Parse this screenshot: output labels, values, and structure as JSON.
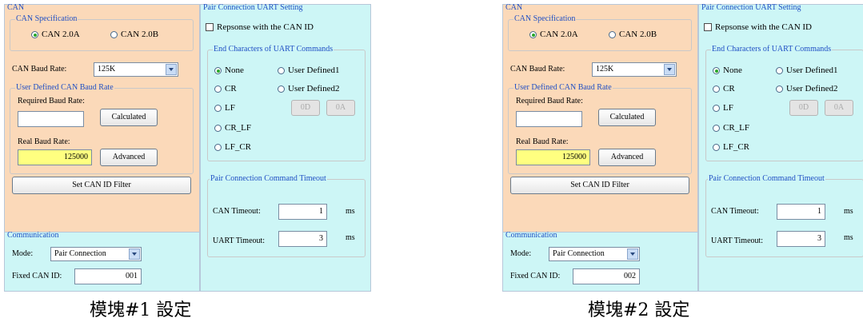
{
  "modules": [
    {
      "caption": "模塊#1 設定",
      "can": {
        "title": "CAN",
        "spec_title": "CAN Specification",
        "spec_a": "CAN 2.0A",
        "spec_b": "CAN 2.0B",
        "spec_selected": "CAN 2.0A",
        "baud_label": "CAN Baud Rate:",
        "baud_value": "125K",
        "user_title": "User Defined CAN Baud Rate",
        "required_label": "Required Baud Rate:",
        "required_value": "",
        "calculated_btn": "Calculated",
        "real_label": "Real Baud Rate:",
        "real_value": "125000",
        "advanced_btn": "Advanced",
        "filter_btn": "Set CAN ID Filter"
      },
      "comm": {
        "title": "Communication",
        "mode_label": "Mode:",
        "mode_value": "Pair Connection",
        "fixed_label": "Fixed CAN ID:",
        "fixed_value": "001"
      },
      "uart": {
        "title": "Pair Connection UART Setting",
        "response_label": "Repsonse with the CAN ID",
        "response_checked": false,
        "end_title": "End Characters of UART Commands",
        "opt_none": "None",
        "opt_cr": "CR",
        "opt_lf": "LF",
        "opt_crlf": "CR_LF",
        "opt_lfcr": "LF_CR",
        "opt_ud1": "User Defined1",
        "opt_ud2": "User Defined2",
        "selected": "None",
        "hex1": "0D",
        "hex2": "0A",
        "timeout_title": "Pair Connection Command Timeout",
        "can_timeout_label": "CAN Timeout:",
        "can_timeout_value": "1",
        "uart_timeout_label": "UART Timeout:",
        "uart_timeout_value": "3",
        "unit": "ms"
      }
    },
    {
      "caption": "模塊#2 設定",
      "can": {
        "title": "CAN",
        "spec_title": "CAN Specification",
        "spec_a": "CAN 2.0A",
        "spec_b": "CAN 2.0B",
        "spec_selected": "CAN 2.0A",
        "baud_label": "CAN Baud Rate:",
        "baud_value": "125K",
        "user_title": "User Defined CAN Baud Rate",
        "required_label": "Required Baud Rate:",
        "required_value": "",
        "calculated_btn": "Calculated",
        "real_label": "Real Baud Rate:",
        "real_value": "125000",
        "advanced_btn": "Advanced",
        "filter_btn": "Set CAN ID Filter"
      },
      "comm": {
        "title": "Communication",
        "mode_label": "Mode:",
        "mode_value": "Pair Connection",
        "fixed_label": "Fixed CAN ID:",
        "fixed_value": "002"
      },
      "uart": {
        "title": "Pair Connection UART Setting",
        "response_label": "Repsonse with the CAN ID",
        "response_checked": false,
        "end_title": "End Characters of UART Commands",
        "opt_none": "None",
        "opt_cr": "CR",
        "opt_lf": "LF",
        "opt_crlf": "CR_LF",
        "opt_lfcr": "LF_CR",
        "opt_ud1": "User Defined1",
        "opt_ud2": "User Defined2",
        "selected": "None",
        "hex1": "0D",
        "hex2": "0A",
        "timeout_title": "Pair Connection Command Timeout",
        "can_timeout_label": "CAN Timeout:",
        "can_timeout_value": "1",
        "uart_timeout_label": "UART Timeout:",
        "uart_timeout_value": "3",
        "unit": "ms"
      }
    }
  ]
}
